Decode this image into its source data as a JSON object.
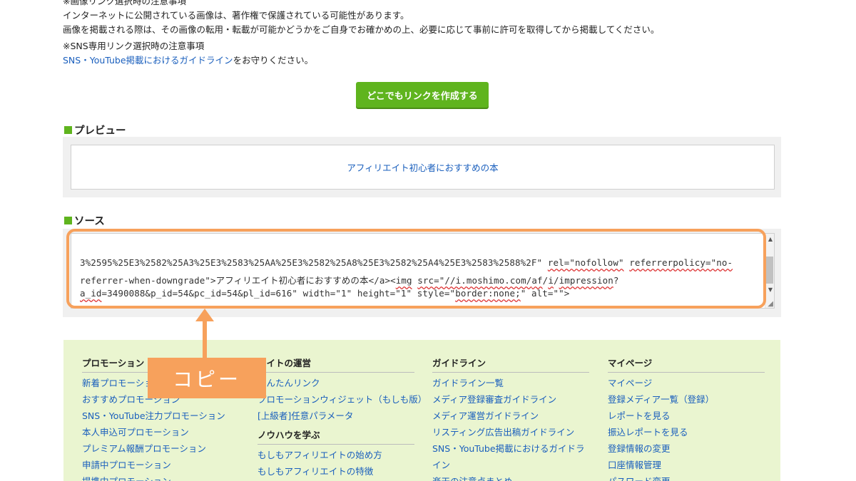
{
  "notices": {
    "image_title": "※画像リンク選択時の注意事項",
    "image_line1": "インターネットに公開されている画像は、著作権で保護されている可能性があります。",
    "image_line2": "画像を掲載される際は、その画像の転用・転載が可能かどうかをご自身でお確かめの上、必要に応じて事前に許可を取得してから掲載してください。",
    "sns_title": "※SNS専用リンク選択時の注意事項",
    "sns_link": "SNS・YouTube掲載におけるガイドライン",
    "sns_suffix": "をお守りください。"
  },
  "create_button": "どこでもリンクを作成する",
  "preview": {
    "heading": "プレビュー",
    "link_text": "アフィリエイト初心者におすすめの本"
  },
  "source": {
    "heading": "ソース",
    "line1": "3%2595%25E3%2582%25A3%25E3%2583%25AA%25E3%2582%25A8%25E3%2582%25A4%25E3%2583%2588%2F\"",
    "line1b": "rel=\"nofollow\"",
    "line1c": "referrerpolicy=\"no-",
    "line2a": "referrer-when-downgrade\">アフィリエイト初心者におすすめの本</a><",
    "line2b": "img",
    "line2c": "src=\"//i.moshimo.com/",
    "line2d": "af",
    "line2e": "/",
    "line2f": "i",
    "line2g": "/",
    "line2h": "impression",
    "line2i": "?",
    "line3a": "a_id",
    "line3b": "=3490088&p_id=54&pc_id=54&pl_id=616\" width=\"1\" height=\"1\" style=\"",
    "line3c": "border:none;",
    "line3d": "\" alt=\"\">"
  },
  "annotation": {
    "copy_label": "コピー"
  },
  "footer": {
    "col1": {
      "heading": "プロモーション",
      "items": [
        "新着プロモーション",
        "おすすめプロモーション",
        "SNS・YouTube注力プロモーション",
        "本人申込可プロモーション",
        "プレミアム報酬プロモーション",
        "申請中プロモーション",
        "提携中プロモーション"
      ]
    },
    "col2": {
      "heading": "サイトの運営",
      "items": [
        "かんたんリンク",
        "プロモーションウィジェット（もしも版）",
        "[上級者]任意パラメータ"
      ],
      "heading2": "ノウハウを学ぶ",
      "items2": [
        "もしもアフィリエイトの始め方",
        "もしもアフィリエイトの特徴"
      ]
    },
    "col3": {
      "heading": "ガイドライン",
      "items": [
        "ガイドライン一覧",
        "メディア登録審査ガイドライン",
        "メディア運営ガイドライン",
        "リスティング広告出稿ガイドライン",
        "SNS・YouTube掲載におけるガイドラ",
        "イン",
        "楽天の注意点まとめ"
      ]
    },
    "col4": {
      "heading": "マイページ",
      "items": [
        "マイページ",
        "登録メディア一覧（登録）",
        "レポートを見る",
        "振込レポートを見る",
        "登録情報の変更",
        "口座情報管理",
        "パスワード変更"
      ]
    }
  }
}
